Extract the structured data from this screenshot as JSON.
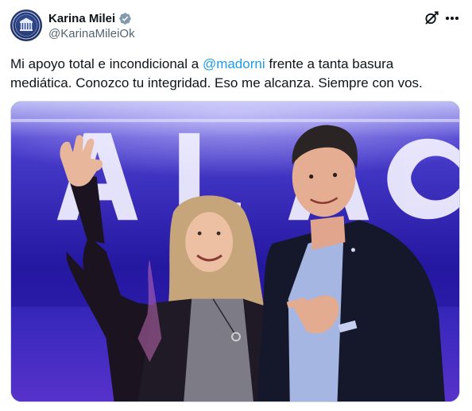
{
  "tweet": {
    "author": {
      "display_name": "Karina Milei",
      "handle": "@KarinaMileiOk",
      "verified": true,
      "avatar_icon": "argentine-seal-avatar"
    },
    "text_before": "Mi apoyo total e incondicional a ",
    "mention": "@madorni",
    "text_after": " frente a tanta basura mediática. Conozco tu integridad. Eso me alcanza. Siempre con vos.",
    "media": {
      "background_letters": "A L A C",
      "alt": ""
    },
    "actions": {
      "grok_icon": "grok-icon",
      "more_icon": "more-options-icon"
    }
  },
  "colors": {
    "text_primary": "#0f1419",
    "text_secondary": "#536471",
    "link": "#1d9bf0",
    "verified_badge": "#829aab",
    "border": "#cfd9de"
  }
}
